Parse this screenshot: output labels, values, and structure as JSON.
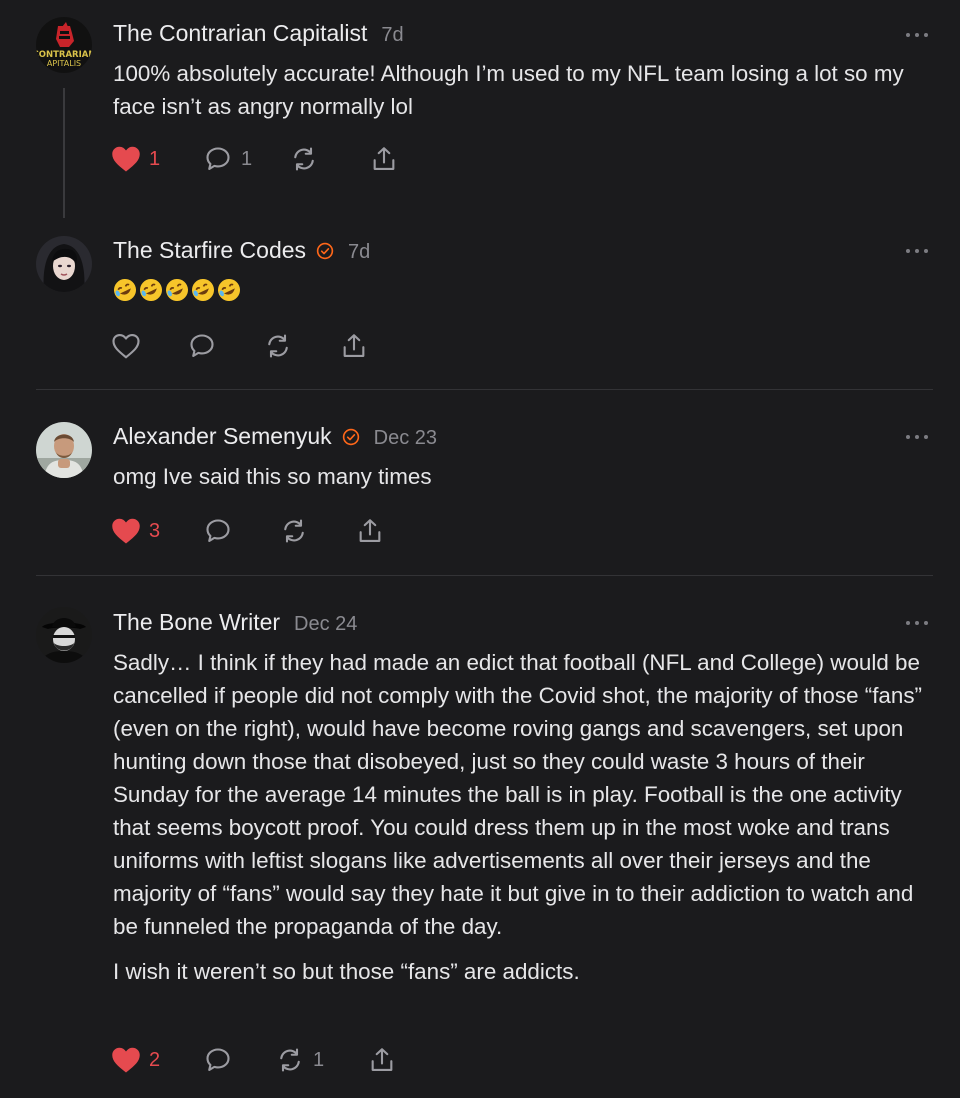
{
  "colors": {
    "background": "#1b1b1d",
    "accent": "#ff6719",
    "like": "#e54a4f",
    "muted": "#8a8a90"
  },
  "comments": [
    {
      "author": "The Contrarian Capitalist",
      "verified": false,
      "time": "7d",
      "avatar": {
        "kind": "logo",
        "text_top": "CONTRARIAN",
        "text_bottom": "APITALIS"
      },
      "paragraphs": [
        "100% absolutely accurate! Although I’m used to my NFL team losing a lot so my face isn’t as angry normally lol"
      ],
      "likes": "1",
      "liked": true,
      "replies": "1",
      "restacks": "",
      "icons": [
        "heart-icon",
        "comment-icon",
        "restack-icon",
        "share-icon"
      ]
    },
    {
      "author": "The Starfire Codes",
      "verified": true,
      "time": "7d",
      "emoji": [
        "🤣",
        "🤣",
        "🤣",
        "🤣",
        "🤣"
      ],
      "likes": "",
      "liked": false,
      "replies": "",
      "restacks": ""
    },
    {
      "author": "Alexander Semenyuk",
      "verified": true,
      "time": "Dec 23",
      "paragraphs": [
        "omg Ive said this so many times"
      ],
      "likes": "3",
      "liked": true,
      "replies": "",
      "restacks": ""
    },
    {
      "author": "The Bone Writer",
      "verified": false,
      "time": "Dec 24",
      "paragraphs": [
        "Sadly… I think if they had made an edict that football (NFL and College) would be cancelled if people did not comply with the Covid shot, the majority of those “fans” (even on the right), would have become roving gangs and scavengers, set upon hunting down those that disobeyed, just so they could waste 3 hours of their Sunday for the average 14 minutes the ball is in play. Football is the one activity that seems boycott proof. You could dress them up in the most woke and trans uniforms with leftist slogans like advertisements all over their jerseys and the majority of “fans” would say they hate it but give in to their addiction to watch and be funneled the propaganda of the day.",
        "I wish it weren’t so but those “fans” are addicts."
      ],
      "likes": "2",
      "liked": true,
      "replies": "",
      "restacks": "1"
    }
  ]
}
